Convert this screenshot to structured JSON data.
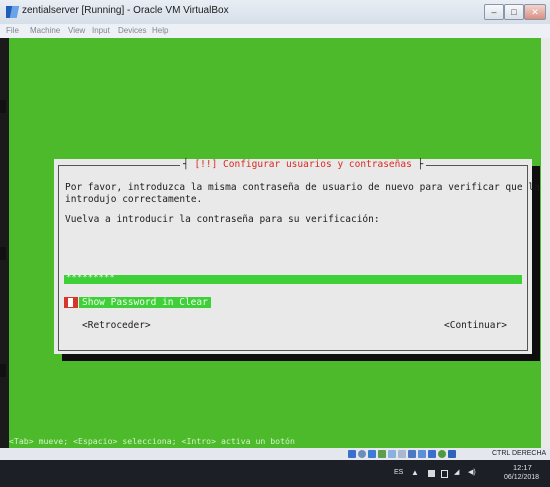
{
  "window": {
    "title": "zentialserver [Running] - Oracle VM VirtualBox",
    "controls": {
      "minimize": "–",
      "maximize": "□",
      "close": "✕"
    }
  },
  "menu": [
    "File",
    "Machine",
    "View",
    "Input",
    "Devices",
    "Help"
  ],
  "dialog": {
    "title": "[!!] Configurar usuarios y contraseñas",
    "line1": "Por favor, introduzca la misma contraseña de usuario de nuevo para verificar que la",
    "line2": "introdujo correctamente.",
    "prompt": "Vuelva a introducir la contraseña para su verificación:",
    "password_mask": "*********",
    "checkbox_label": "Show Password in Clear",
    "checkbox_checked": false,
    "back_button": "<Retroceder>",
    "continue_button": "<Continuar>"
  },
  "hint": "<Tab> mueve; <Espacio> selecciona; <Intro> activa un botón",
  "statusbar": {
    "host_key": "CTRL DERECHA"
  },
  "taskbar": {
    "language": "ES",
    "time": "12:17",
    "date": "06/12/2018"
  },
  "colors": {
    "screen": "#4cba2a",
    "dialog": "#e9e9e9",
    "title_red": "#d92a1e",
    "field_green": "#3fcf38"
  }
}
